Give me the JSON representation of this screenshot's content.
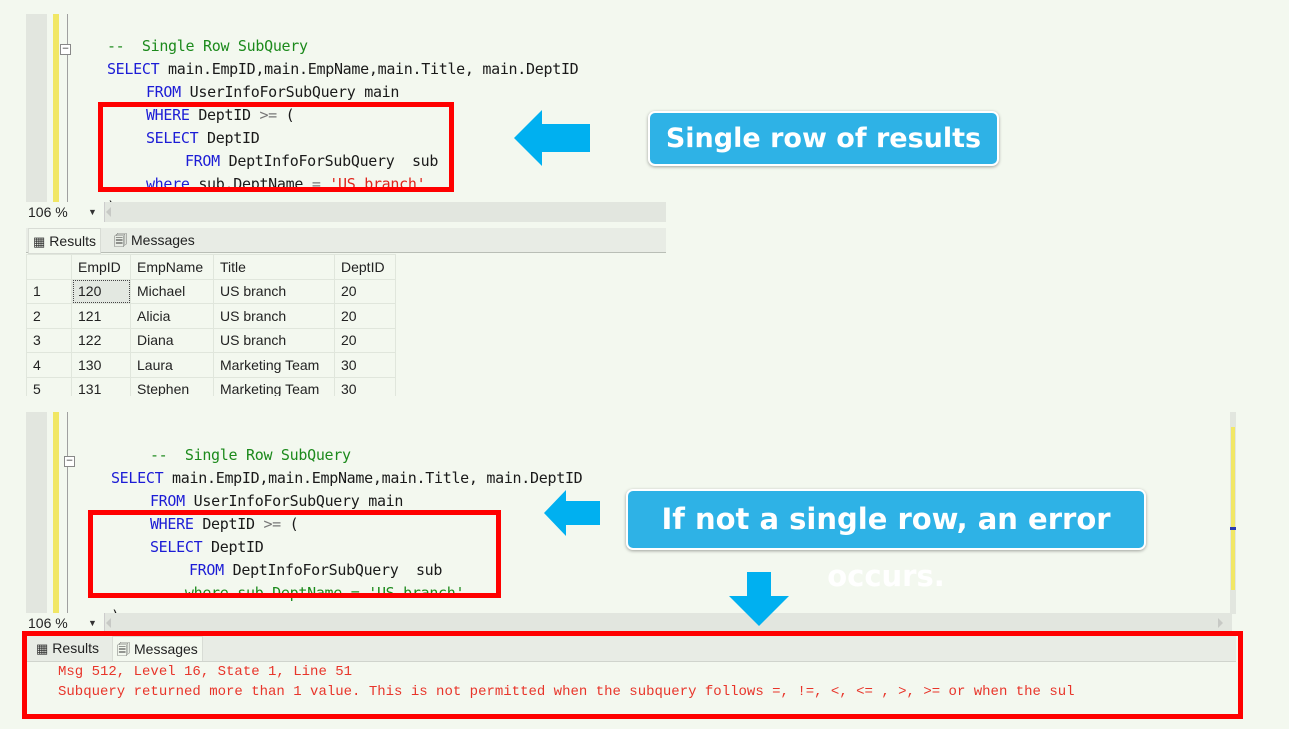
{
  "top_panel": {
    "code_lines": [
      {
        "comment": "--  Single Row SubQuery"
      },
      {
        "keyword": "SELECT",
        "text": " main.EmpID,main.EmpName,main.Title, main.DeptID"
      },
      {
        "keyword": "FROM",
        "text": " UserInfoForSubQuery main"
      },
      {
        "keyword": "WHERE",
        "text": " DeptID ",
        "op": ">=",
        "text2": " ("
      },
      {
        "keyword": "SELECT",
        "text": " DeptID"
      },
      {
        "keyword": "FROM",
        "text": " DeptInfoForSubQuery  sub"
      },
      {
        "keyword": "where",
        "text": " sub.DeptName ",
        "op": "=",
        "string": " 'US branch'"
      },
      {
        "text": ");"
      }
    ],
    "zoom_level": "106 %",
    "tabs": {
      "results": "Results",
      "messages": "Messages"
    },
    "grid": {
      "columns": [
        "EmpID",
        "EmpName",
        "Title",
        "DeptID"
      ],
      "rows": [
        {
          "n": "1",
          "cells": [
            "120",
            "Michael",
            "US branch",
            "20"
          ]
        },
        {
          "n": "2",
          "cells": [
            "121",
            "Alicia",
            "US branch",
            "20"
          ]
        },
        {
          "n": "3",
          "cells": [
            "122",
            "Diana",
            "US branch",
            "20"
          ]
        },
        {
          "n": "4",
          "cells": [
            "130",
            "Laura",
            "Marketing Team",
            "30"
          ]
        },
        {
          "n": "5",
          "cells": [
            "131",
            "Stephen",
            "Marketing Team",
            "30"
          ]
        }
      ]
    },
    "callout": "Single row of results"
  },
  "bottom_panel": {
    "code_lines": [
      {
        "comment": "--  Single Row SubQuery"
      },
      {
        "keyword": "SELECT",
        "text": " main.EmpID,main.EmpName,main.Title, main.DeptID"
      },
      {
        "keyword": "FROM",
        "text": " UserInfoForSubQuery main"
      },
      {
        "keyword": "WHERE",
        "text": " DeptID ",
        "op": ">=",
        "text2": " ("
      },
      {
        "keyword": "SELECT",
        "text": " DeptID"
      },
      {
        "keyword": "FROM",
        "text": " DeptInfoForSubQuery  sub"
      },
      {
        "comment": "--  where sub.DeptName = 'US branch'"
      },
      {
        "text": "),"
      }
    ],
    "zoom_level": "106 %",
    "tabs": {
      "results": "Results",
      "messages": "Messages"
    },
    "messages": [
      "Msg 512, Level 16, State 1, Line 51",
      "Subquery returned more than 1 value. This is not permitted when the subquery follows =, !=, <, <= , >, >= or when the sul"
    ],
    "callout": "If not a single row, an error occurs."
  },
  "icons": {
    "results_tab": "grid-icon",
    "messages_tab": "messages-icon",
    "arrow_left": "arrow-left-icon",
    "arrow_down": "arrow-down-icon"
  },
  "colors": {
    "highlight_box": "#ff0000",
    "callout_bg": "#2eb2e6",
    "arrow": "#00b0f0",
    "keyword": "#1c1cd6",
    "comment": "#1c8a1c",
    "string": "#e0241c",
    "error_text": "#e8352a"
  }
}
